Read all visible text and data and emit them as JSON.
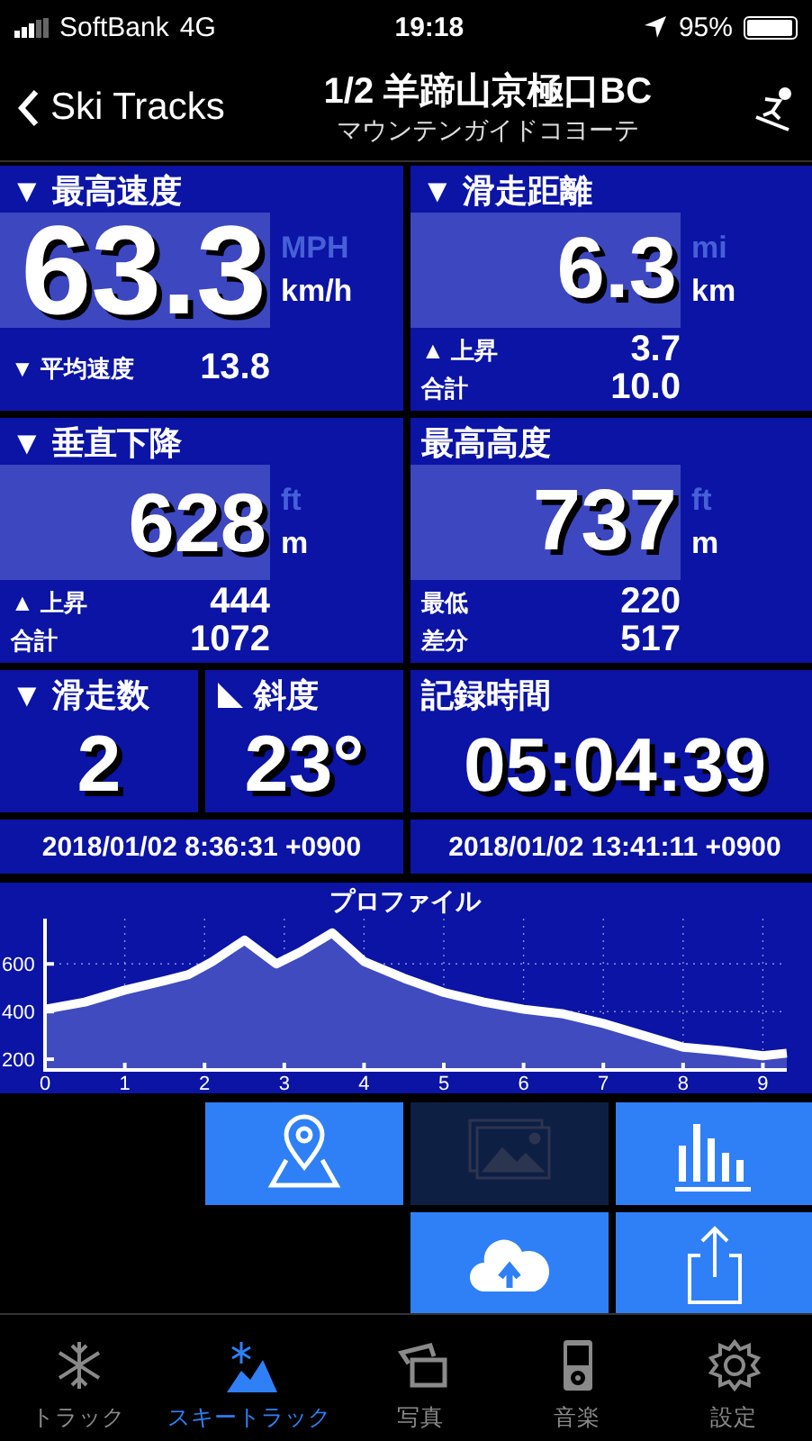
{
  "status_bar": {
    "carrier": "SoftBank",
    "network": "4G",
    "time": "19:18",
    "battery": "95%"
  },
  "nav": {
    "back": "Ski Tracks",
    "title": "1/2 羊蹄山京極口BC",
    "subtitle": "マウンテンガイドコヨーテ"
  },
  "tiles": [
    {
      "kind": "big",
      "label": "▼ 最高速度",
      "value": "63.3",
      "units": [
        {
          "text": "MPH",
          "selected": false
        },
        {
          "text": "km/h",
          "selected": true
        }
      ],
      "stats": [
        {
          "label": "▼ 平均速度",
          "value": "13.8"
        }
      ]
    },
    {
      "kind": "big",
      "label": "▼ 滑走距離",
      "value": "6.3",
      "units": [
        {
          "text": "mi",
          "selected": false
        },
        {
          "text": "km",
          "selected": true
        }
      ],
      "stats": [
        {
          "label": "▲ 上昇",
          "value": "3.7"
        },
        {
          "label": "合計",
          "value": "10.0"
        }
      ]
    },
    {
      "kind": "big",
      "label": "▼ 垂直下降",
      "value": "628",
      "units": [
        {
          "text": "ft",
          "selected": false
        },
        {
          "text": "m",
          "selected": true
        }
      ],
      "stats": [
        {
          "label": "▲ 上昇",
          "value": "444"
        },
        {
          "label": "合計",
          "value": "1072"
        }
      ]
    },
    {
      "kind": "big",
      "label": "最高高度",
      "value": "737",
      "units": [
        {
          "text": "ft",
          "selected": false
        },
        {
          "text": "m",
          "selected": true
        }
      ],
      "stats": [
        {
          "label": "最低",
          "value": "220"
        },
        {
          "label": "差分",
          "value": "517"
        }
      ]
    },
    {
      "kind": "small",
      "label": "▼ 滑走数",
      "value": "2"
    },
    {
      "kind": "slope",
      "label": "斜度",
      "value": "23°"
    },
    {
      "kind": "small",
      "label": "記録時間",
      "value": "05:04:39"
    }
  ],
  "dates": [
    "2018/01/02 8:36:31 +0900",
    "2018/01/02 13:41:11 +0900"
  ],
  "profile": {
    "chart_data": {
      "type": "area",
      "title": "プロファイル",
      "x": [
        0,
        0.5,
        1,
        1.5,
        1.8,
        2.1,
        2.5,
        2.9,
        3.2,
        3.6,
        4,
        4.5,
        5,
        5.5,
        6,
        6.5,
        7,
        7.5,
        8,
        8.5,
        9,
        9.3
      ],
      "grid": true,
      "series": [
        {
          "color": "#ffffff",
          "values": [
            410,
            440,
            490,
            530,
            555,
            610,
            700,
            600,
            650,
            730,
            610,
            540,
            480,
            440,
            410,
            390,
            350,
            300,
            250,
            235,
            215,
            225
          ]
        }
      ],
      "xlim": [
        0,
        9.3
      ],
      "ylim": [
        155,
        790
      ],
      "xticks": [
        0,
        1,
        2,
        3,
        4,
        5,
        6,
        7,
        8,
        9
      ],
      "yticks": [
        200,
        400,
        600
      ]
    }
  },
  "actions": [
    {
      "disabled": false
    },
    {
      "disabled": true
    },
    {
      "disabled": false
    },
    {
      "disabled": false
    },
    {
      "disabled": false
    }
  ],
  "tabs": [
    {
      "label": "トラック",
      "selected": false
    },
    {
      "label": "スキートラック",
      "selected": true
    },
    {
      "label": "写真",
      "selected": false
    },
    {
      "label": "音楽",
      "selected": false
    },
    {
      "label": "設定",
      "selected": false
    }
  ]
}
